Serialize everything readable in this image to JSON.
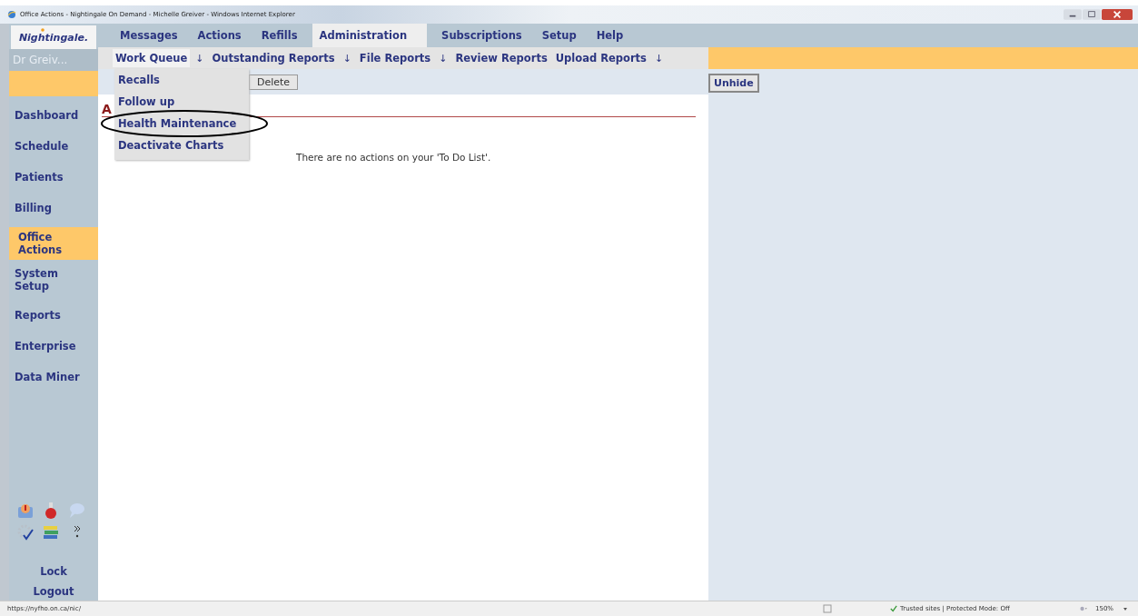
{
  "window": {
    "title": "Office Actions - Nightingale On Demand - Michelle Greiver - Windows Internet Explorer"
  },
  "logo": {
    "text": "Nightingale."
  },
  "user": "Dr Greiv...",
  "top_menu": [
    {
      "label": "Messages",
      "selected": false
    },
    {
      "label": "Actions",
      "selected": false
    },
    {
      "label": "Refills",
      "selected": false
    },
    {
      "label": "Administration",
      "selected": true
    },
    {
      "label": "Subscriptions",
      "selected": false
    },
    {
      "label": "Setup",
      "selected": false
    },
    {
      "label": "Help",
      "selected": false
    }
  ],
  "sub_menu": [
    {
      "label": "Work Queue",
      "selected": true,
      "arrow": "↓"
    },
    {
      "label": "Outstanding Reports",
      "selected": false,
      "arrow": "↓"
    },
    {
      "label": "File Reports",
      "selected": false,
      "arrow": "↓"
    },
    {
      "label": "Review Reports",
      "selected": false
    },
    {
      "label": "Upload Reports",
      "selected": false,
      "arrow": "↓"
    }
  ],
  "dropdown": [
    {
      "label": "Recalls",
      "circled": false
    },
    {
      "label": "Follow up",
      "circled": false
    },
    {
      "label": "Health Maintenance",
      "circled": true
    },
    {
      "label": "Deactivate Charts",
      "circled": false
    }
  ],
  "toolbar": {
    "button": "Delete"
  },
  "heading": "A",
  "message": "There are no actions on your 'To Do List'.",
  "side_nav": [
    {
      "label": "Dashboard",
      "selected": false
    },
    {
      "label": "Schedule",
      "selected": false
    },
    {
      "label": "Patients",
      "selected": false
    },
    {
      "label": "Billing",
      "selected": false
    },
    {
      "label": "Office Actions",
      "selected": true
    },
    {
      "label": "System Setup",
      "selected": false
    },
    {
      "label": "Reports",
      "selected": false
    },
    {
      "label": "Enterprise",
      "selected": false
    },
    {
      "label": "Data Miner",
      "selected": false
    }
  ],
  "side_bottom": [
    "Lock",
    "Logout"
  ],
  "right_panel": {
    "button": "Unhide"
  },
  "status_bar": {
    "url": "https://nyfho.on.ca/nic/",
    "zone": "Trusted sites | Protected Mode: Off",
    "zoom": "150%"
  }
}
